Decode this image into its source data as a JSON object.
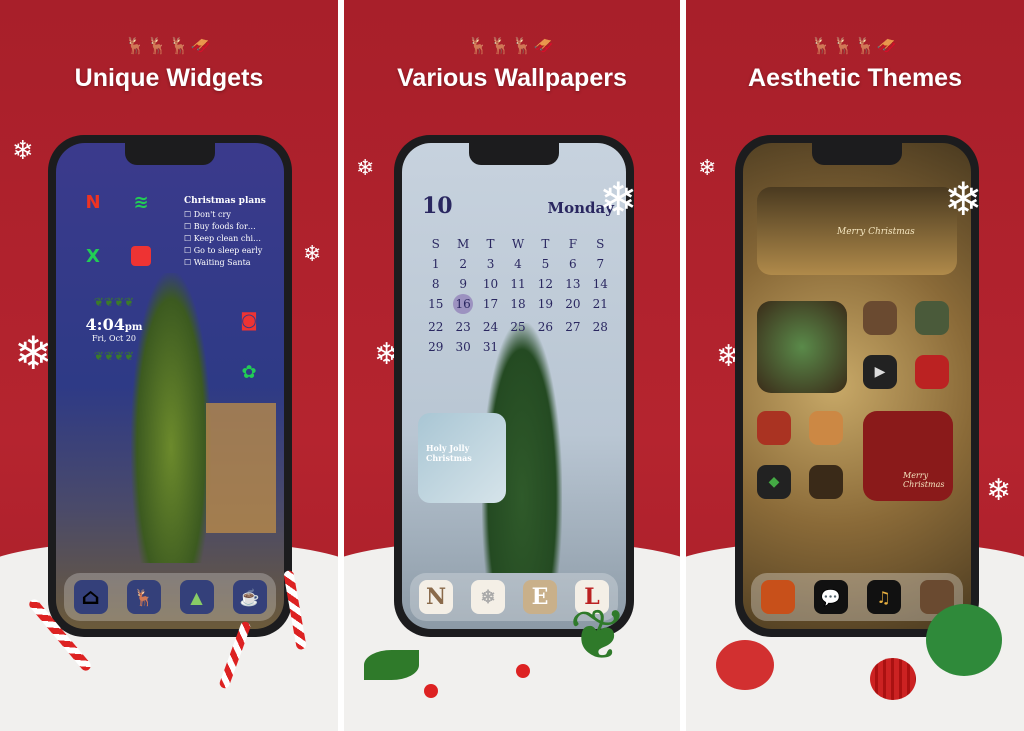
{
  "panels": [
    {
      "title": "Unique Widgets",
      "widget": {
        "title": "Christmas plans",
        "items": [
          "Don't cry",
          "Buy foods for…",
          "Keep clean chi…",
          "Go to sleep early",
          "Waiting Santa"
        ],
        "time": "4:04",
        "ampm": "pm",
        "date": "Fri, Oct 20"
      },
      "apps": [
        "netflix-icon",
        "spotify-icon",
        "x-icon",
        "red-square-icon",
        "camera-icon",
        "flower-icon"
      ]
    },
    {
      "title": "Various Wallpapers",
      "calendar": {
        "day": "10",
        "weekday": "Monday",
        "headers": [
          "S",
          "M",
          "T",
          "W",
          "T",
          "F",
          "S"
        ],
        "days": [
          "1",
          "2",
          "3",
          "4",
          "5",
          "6",
          "7",
          "8",
          "9",
          "10",
          "11",
          "12",
          "13",
          "14",
          "15",
          "16",
          "17",
          "18",
          "19",
          "20",
          "21",
          "22",
          "23",
          "24",
          "25",
          "26",
          "27",
          "28",
          "29",
          "30",
          "31"
        ],
        "today": "16"
      },
      "photo_widget": "Holy Jolly Christmas",
      "dock": [
        "N",
        "❄",
        "E",
        "L"
      ]
    },
    {
      "title": "Aesthetic Themes",
      "banner": "Merry Christmas",
      "card": "Merry Christmas"
    }
  ],
  "colors": {
    "background_red": "#b5242f",
    "snow": "#f1f0ee",
    "calendar_text": "#2a2760"
  }
}
